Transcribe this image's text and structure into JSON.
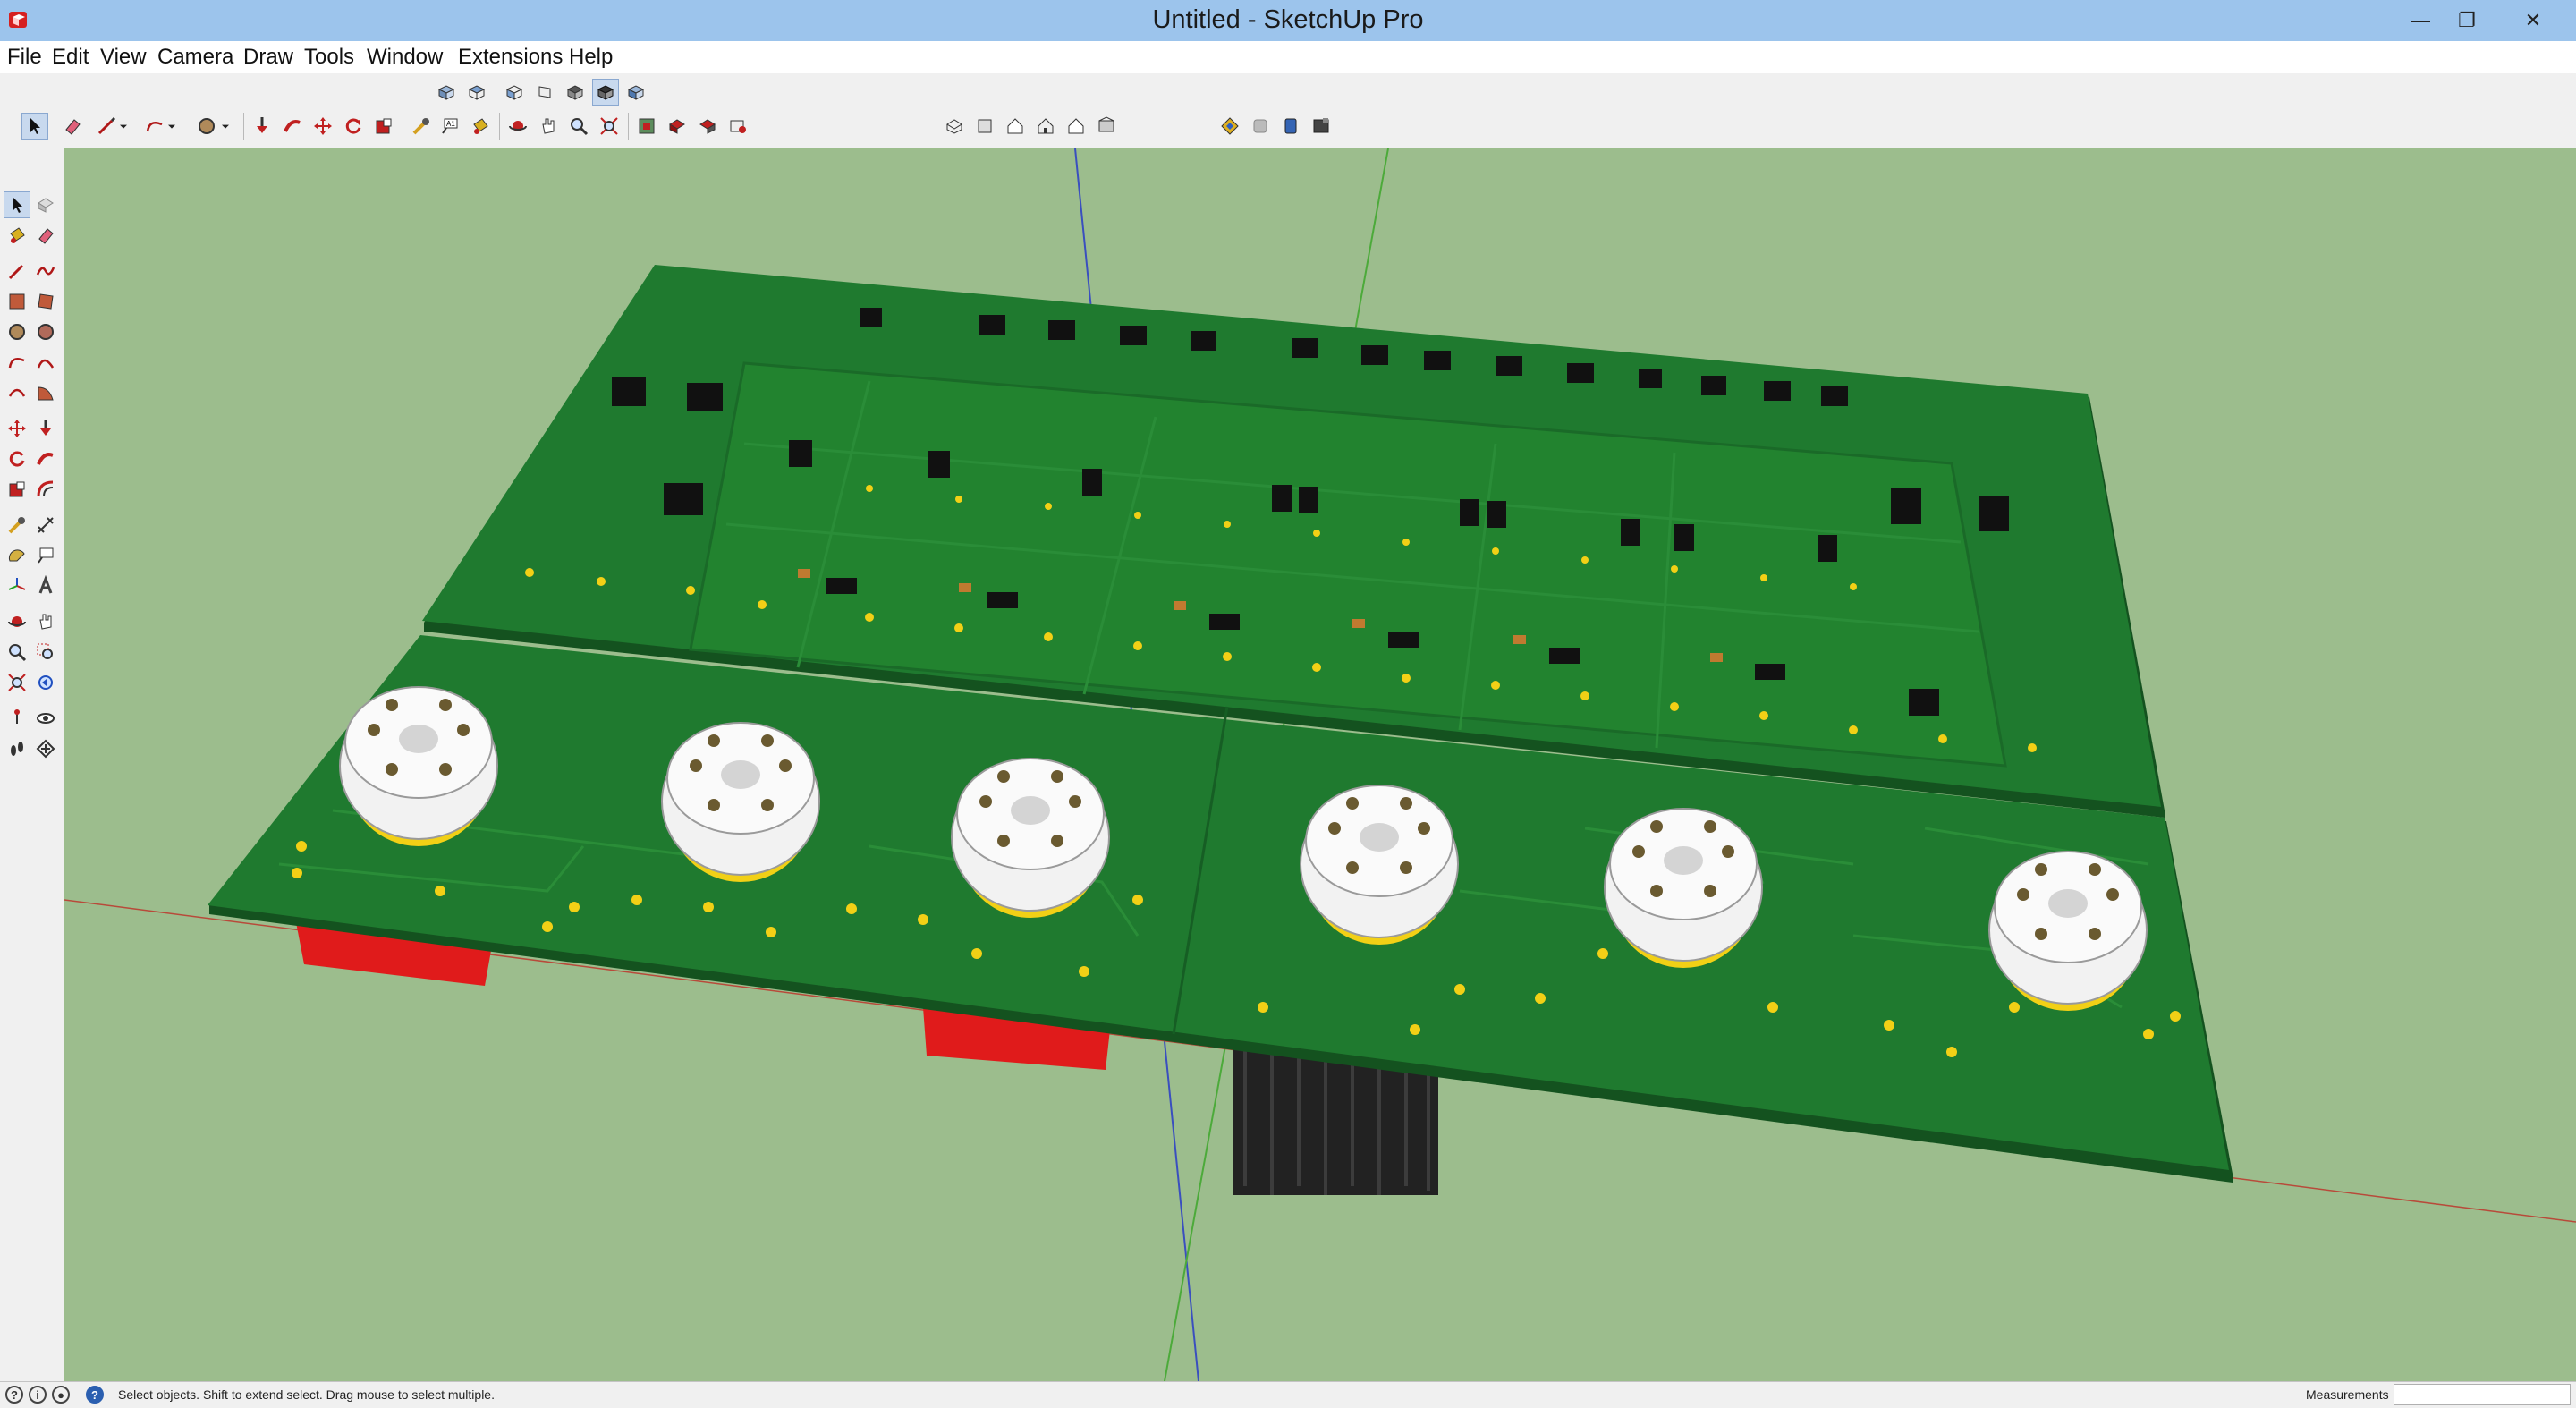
{
  "window": {
    "title": "Untitled - SketchUp Pro",
    "minimize_glyph": "—",
    "maximize_glyph": "❐",
    "close_glyph": "✕"
  },
  "menu": {
    "items": [
      "File",
      "Edit",
      "View",
      "Camera",
      "Draw",
      "Tools",
      "Window",
      "Extensions",
      "Help"
    ]
  },
  "toolbar": {
    "row1_icons": [
      "iso-view-icon",
      "top-view-icon",
      "front-view-icon",
      "right-view-icon",
      "back-view-icon",
      "left-view-icon",
      "bottom-view-icon"
    ],
    "row2_icons": [
      "select-icon",
      "eraser-icon",
      "line-icon",
      "arc-icon",
      "circle-icon",
      "pushpull-icon",
      "followme-icon",
      "move-icon",
      "rotate-icon",
      "scale-icon",
      "tape-icon",
      "text-icon",
      "paint-icon",
      "orbit-icon",
      "pan-icon",
      "zoom-icon",
      "zoom-extents-icon",
      "section-icon",
      "components-icon",
      "materials-icon",
      "warehouse-icon",
      "xray-icon",
      "wireframe-icon",
      "hidden-line-icon",
      "shaded-icon",
      "textured-icon",
      "monochrome-icon",
      "layers-icon",
      "styles-icon",
      "extension-warehouse-icon",
      "layout-icon"
    ]
  },
  "palette": {
    "icons": [
      "select-icon",
      "make-component-icon",
      "paint-bucket-icon",
      "eraser-icon",
      "line-icon",
      "freehand-icon",
      "rectangle-icon",
      "rotated-rectangle-icon",
      "circle-icon",
      "polygon-icon",
      "arc-icon",
      "two-point-arc-icon",
      "three-point-arc-icon",
      "pie-icon",
      "move-icon",
      "pushpull-icon",
      "rotate-icon",
      "followme-icon",
      "scale-icon",
      "offset-icon",
      "tape-measure-icon",
      "dimension-icon",
      "protractor-icon",
      "text-icon",
      "axes-icon",
      "3d-text-icon",
      "orbit-icon",
      "pan-icon",
      "zoom-icon",
      "zoom-window-icon",
      "zoom-extents-icon",
      "previous-view-icon",
      "position-camera-icon",
      "look-around-icon",
      "walk-icon",
      "section-plane-icon"
    ]
  },
  "status": {
    "message": "Select objects. Shift to extend select. Drag mouse to select multiple.",
    "measurements_label": "Measurements",
    "measurements_value": "",
    "icons": [
      "geo-location-icon",
      "credits-icon",
      "user-icon",
      "help-icon"
    ]
  },
  "colors": {
    "title_bar": "#9cc4ec",
    "viewport_bg": "#9cbd8d",
    "pcb_green": "#1f7a2f",
    "pcb_edge": "#14521f",
    "pad_yellow": "#f2d016",
    "socket_white": "#f2f2f2",
    "heatsink": "#222222",
    "red_component": "#e01b1b"
  }
}
